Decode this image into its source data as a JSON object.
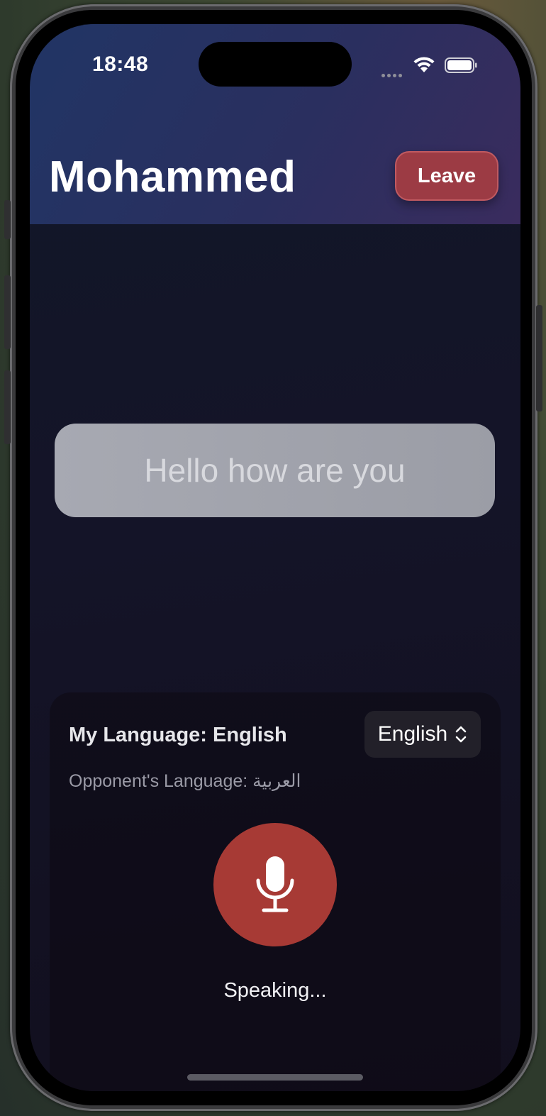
{
  "status_bar": {
    "time": "18:48"
  },
  "header": {
    "title": "Mohammed",
    "leave_label": "Leave"
  },
  "transcript": {
    "text": "Hello how are you"
  },
  "controls": {
    "my_language_label": "My Language: English",
    "language_select_value": "English",
    "opponent_language_label": "Opponent's Language: العربية",
    "mic_icon": "microphone-icon",
    "status": "Speaking..."
  },
  "colors": {
    "accent_leave": "#9c3b44",
    "mic_button": "#a73a35",
    "transcript_bubble": "#a3a5ae"
  }
}
